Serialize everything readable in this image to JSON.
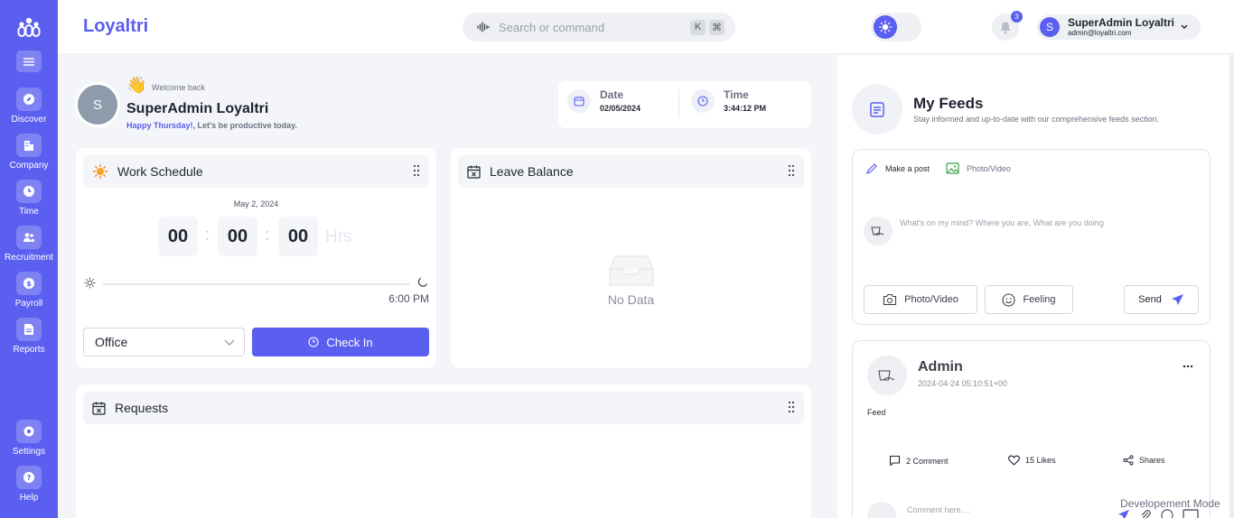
{
  "app": {
    "brand": "Loyaltri"
  },
  "sidebar": {
    "items": [
      {
        "label": "Discover",
        "icon": "compass-icon"
      },
      {
        "label": "Company",
        "icon": "building-icon"
      },
      {
        "label": "Time",
        "icon": "clock-icon"
      },
      {
        "label": "Recruitment",
        "icon": "users-icon"
      },
      {
        "label": "Payroll",
        "icon": "dollar-icon"
      },
      {
        "label": "Reports",
        "icon": "document-icon"
      }
    ],
    "bottom": [
      {
        "label": "Settings",
        "icon": "gear-icon"
      },
      {
        "label": "Help",
        "icon": "help-icon"
      }
    ]
  },
  "header": {
    "search_placeholder": "Search or command",
    "shortcut_keys": [
      "K",
      "⌘"
    ],
    "notification_count": "3",
    "user": {
      "initial": "S",
      "name": "SuperAdmin Loyaltri",
      "email": "admin@loyaltri.com"
    }
  },
  "welcome": {
    "avatar_initial": "S",
    "greeting": "Welcome back",
    "name": "SuperAdmin Loyaltri",
    "day_highlight": "Happy Thursday!",
    "tagline": ", Let's be productive today."
  },
  "datetime": {
    "date_label": "Date",
    "date_value": "02/05/2024",
    "time_label": "Time",
    "time_value": "3:44:12 PM"
  },
  "work_schedule": {
    "title": "Work Schedule",
    "date": "May 2, 2024",
    "hours": "00",
    "minutes": "00",
    "seconds": "00",
    "separator": ":",
    "unit": "Hrs",
    "end_time": "6:00 PM",
    "location": "Office",
    "checkin_label": "Check In",
    "progress": 0
  },
  "leave_balance": {
    "title": "Leave Balance",
    "empty_text": "No Data"
  },
  "requests": {
    "title": "Requests"
  },
  "feeds": {
    "title": "My Feeds",
    "subtitle": "Stay informed and up-to-date with our comprehensive feeds section.",
    "make_post": "Make a post",
    "photo_video_tab": "Photo/Video",
    "placeholder": "What's on my mind? Where you are, What are you doing",
    "photo_video_btn": "Photo/Video",
    "feeling_btn": "Feeling",
    "send_btn": "Send",
    "post": {
      "author": "Admin",
      "timestamp": "2024-04-24 05:10:51+00",
      "body": "Feed",
      "comments": "2 Comment",
      "likes": "15 Likes",
      "shares": "Shares",
      "comment_placeholder": "Comment here...."
    }
  },
  "footer": {
    "mode": "Developement Mode"
  },
  "colors": {
    "accent": "#5b5ff0",
    "background": "#f4f5f9"
  }
}
